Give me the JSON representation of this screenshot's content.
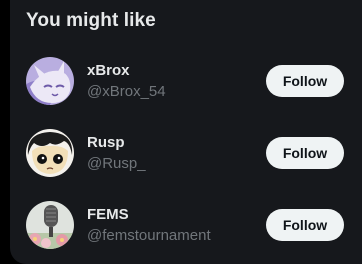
{
  "section": {
    "title": "You might like"
  },
  "suggestions": [
    {
      "name": "xBrox",
      "handle": "@xBrox_54",
      "follow_label": "Follow",
      "avatar_icon": "purple-character-avatar"
    },
    {
      "name": "Rusp",
      "handle": "@Rusp_",
      "follow_label": "Follow",
      "avatar_icon": "dark-hair-face-avatar"
    },
    {
      "name": "FEMS",
      "handle": "@femstournament",
      "follow_label": "Follow",
      "avatar_icon": "microphone-flowers-avatar"
    }
  ],
  "colors": {
    "page_bg": "#000000",
    "panel_bg": "#16181c",
    "primary_text": "#e7e9ea",
    "secondary_text": "#71767b",
    "button_bg": "#eff3f4",
    "button_text": "#0f1419"
  }
}
